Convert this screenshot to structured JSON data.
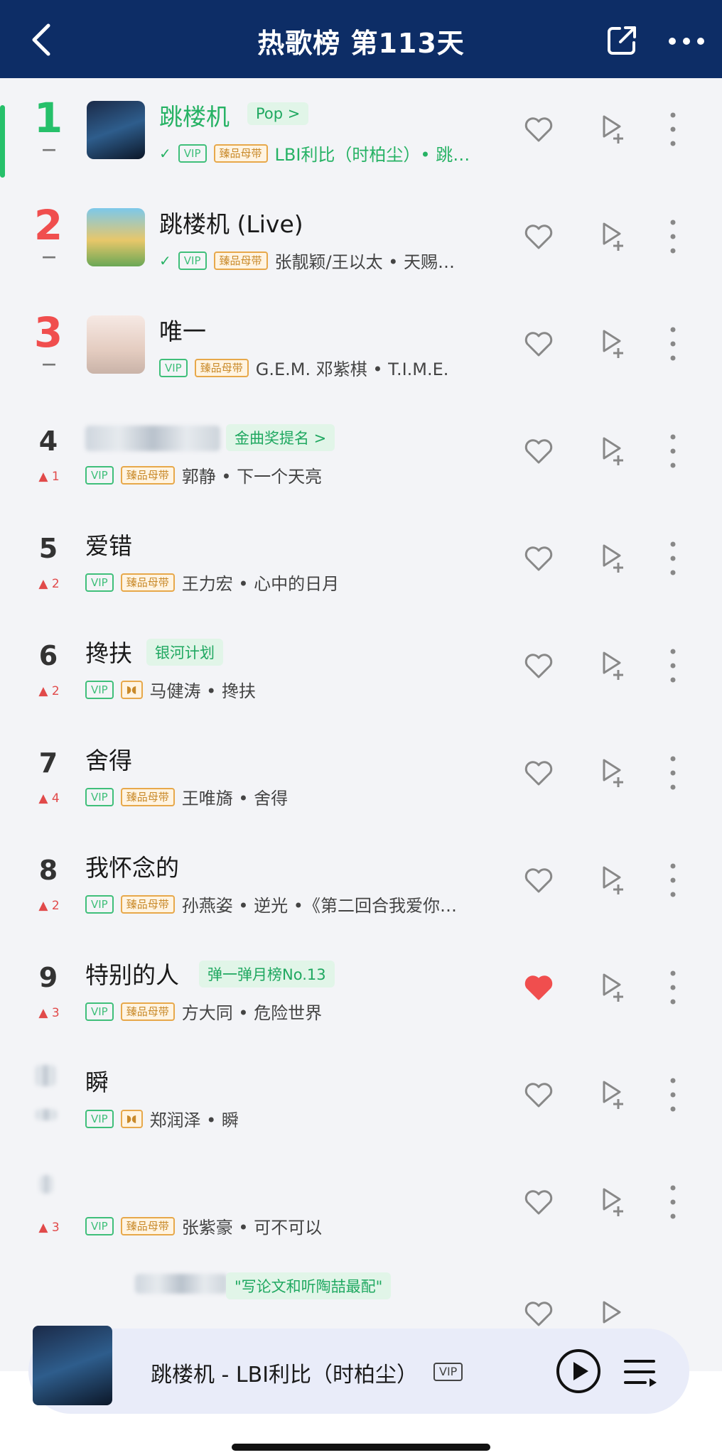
{
  "header": {
    "title": "热歌榜 第113天",
    "back_icon": "chevron-left-icon",
    "share_icon": "share-icon",
    "more_icon": "more-horizontal-icon"
  },
  "rows": [
    {
      "rank": "1",
      "trend": "—",
      "song": "跳楼机",
      "tag": "Pop >",
      "artist": "LBI利比（时柏尘）• 跳…",
      "vip": "VIP",
      "master": "臻品母带"
    },
    {
      "rank": "2",
      "trend": "—",
      "song": "跳楼机 (Live)",
      "vip": "VIP",
      "master": "臻品母带",
      "artist": "张靓颖/王以太 • 天赐…"
    },
    {
      "rank": "3",
      "trend": "—",
      "song": "唯一",
      "vip": "VIP",
      "master": "臻品母带",
      "artist": "G.E.M. 邓紫棋 • T.I.M.E."
    },
    {
      "rank": "4",
      "trend": "▲ 1",
      "tag": "金曲奖提名 >",
      "vip": "VIP",
      "master": "臻品母带",
      "artist": "郭静 • 下一个天亮"
    },
    {
      "rank": "5",
      "trend": "▲ 2",
      "song": "爱错",
      "vip": "VIP",
      "master": "臻品母带",
      "artist": "王力宏 • 心中的日月"
    },
    {
      "rank": "6",
      "trend": "▲ 2",
      "song": "搀扶",
      "tag": "银河计划",
      "vip": "VIP",
      "artist": "马健涛 • 搀扶"
    },
    {
      "rank": "7",
      "trend": "▲ 4",
      "song": "舍得",
      "vip": "VIP",
      "master": "臻品母带",
      "artist": "王唯旖 • 舍得"
    },
    {
      "rank": "8",
      "trend": "▲ 2",
      "song": "我怀念的",
      "vip": "VIP",
      "master": "臻品母带",
      "artist": "孙燕姿 • 逆光 •《第二回合我爱你…"
    },
    {
      "rank": "9",
      "trend": "▲ 3",
      "song": "特别的人",
      "tag": "弹一弹月榜No.13",
      "vip": "VIP",
      "master": "臻品母带",
      "artist": "方大同 • 危险世界"
    },
    {
      "rank": "",
      "trend": "",
      "song": "瞬",
      "vip": "VIP",
      "artist": "郑润泽 • 瞬"
    },
    {
      "rank": "",
      "trend": "▲ 3",
      "song": "",
      "vip": "VIP",
      "master": "臻品母带",
      "artist": "张紫豪 • 可不可以"
    },
    {
      "rank": "",
      "trend": "",
      "tag": "\"写论文和听陶喆最配\""
    }
  ],
  "icons": {
    "heart": "heart-icon",
    "heart_filled": "heart-filled-icon",
    "add_to_playlist": "add-to-playlist-icon",
    "kebab": "more-vertical-icon",
    "dolby": "dolby-icon",
    "check": "check-icon"
  },
  "colors": {
    "header_bg": "#0d2d66",
    "playing_green": "#26b264",
    "rank_red": "#f04e4e",
    "liked_red": "#f04e4e"
  },
  "player": {
    "text": "跳楼机 - LBI利比（时柏尘）",
    "vip": "VIP",
    "play_icon": "play-icon",
    "queue_icon": "playlist-queue-icon"
  }
}
